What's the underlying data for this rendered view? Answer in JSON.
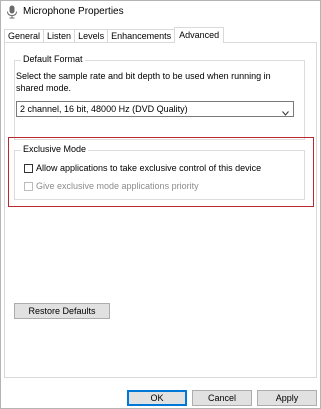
{
  "window": {
    "title": "Microphone Properties",
    "title_icon": "microphone-icon"
  },
  "tabs": [
    {
      "label": "General",
      "active": false
    },
    {
      "label": "Listen",
      "active": false
    },
    {
      "label": "Levels",
      "active": false
    },
    {
      "label": "Enhancements",
      "active": false
    },
    {
      "label": "Advanced",
      "active": true
    }
  ],
  "default_format": {
    "group_title": "Default Format",
    "description": "Select the sample rate and bit depth to be used when running in shared mode.",
    "selected_value": "2 channel, 16 bit, 48000 Hz (DVD Quality)",
    "dropdown_icon": "chevron-down-icon"
  },
  "exclusive_mode": {
    "group_title": "Exclusive Mode",
    "options": [
      {
        "label": "Allow applications to take exclusive control of this device",
        "checked": false,
        "enabled": true
      },
      {
        "label": "Give exclusive mode applications priority",
        "checked": false,
        "enabled": false
      }
    ],
    "highlight_color": "#c0262d"
  },
  "buttons": {
    "restore_defaults": "Restore Defaults",
    "ok": "OK",
    "cancel": "Cancel",
    "apply": "Apply"
  },
  "colors": {
    "ok_border": "#0078d7",
    "button_face": "#e1e1e1"
  }
}
